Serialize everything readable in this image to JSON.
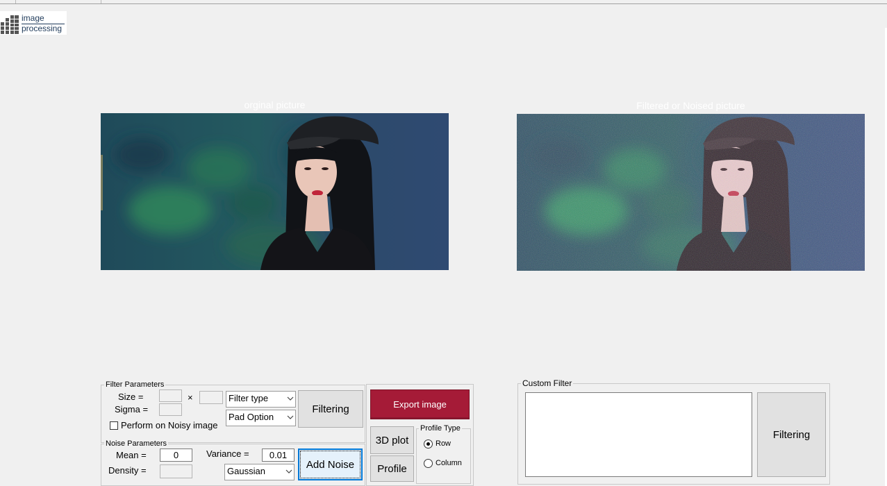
{
  "logo": {
    "line1": "image",
    "line2": "processing"
  },
  "images": {
    "original_title": "orginal picture",
    "filtered_title": "Filtered or Noised picture"
  },
  "filter_params": {
    "legend": "Filter Parameters",
    "size_label": "Size =",
    "times": "×",
    "sigma_label": "Sigma =",
    "filter_type": "Filter type",
    "pad_option": "Pad Option",
    "filtering_label": "Filtering",
    "noisy_checkbox_label": "Perform on Noisy image"
  },
  "noise_params": {
    "legend": "Noise Parameters",
    "mean_label": "Mean =",
    "mean_value": "0",
    "variance_label": "Variance =",
    "variance_value": "0.01",
    "density_label": "Density =",
    "noise_type": "Gaussian",
    "add_noise_label": "Add Noise"
  },
  "actions": {
    "export_label": "Export image",
    "plot3d_label": "3D plot",
    "profile_label": "Profile"
  },
  "profile_type": {
    "legend": "Profile Type",
    "row_label": "Row",
    "column_label": "Column",
    "selected": "Row"
  },
  "custom_filter": {
    "legend": "Custom Filter",
    "filtering_label": "Filtering"
  },
  "colors": {
    "export_button": "#a51b37",
    "focus_border": "#0078d7",
    "background": "#f0f0f0"
  }
}
